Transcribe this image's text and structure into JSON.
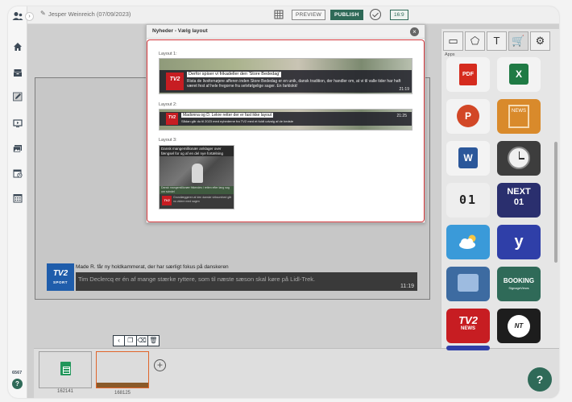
{
  "topbar": {
    "author": "Jesper Weinreich (07/09/2023)",
    "preview_label": "PREVIEW",
    "publish_label": "PUBLISH",
    "ratio_label": "16:9",
    "collapse_glyph": "›"
  },
  "sidebar": {
    "icons": [
      "users-icon",
      "home-icon",
      "inbox-icon",
      "edit-icon",
      "monitor-icon",
      "gallery-icon",
      "calendar-clock-icon",
      "calendar-grid-icon"
    ],
    "count": "6567",
    "help_glyph": "?"
  },
  "canvas": {
    "ticker": {
      "logo_text": "TV2",
      "logo_sub": "SPORT",
      "headline": "Made R. får ny holdkammerat, der har særligt fokus på danskeren",
      "text": "Tim Declercq er én af mange stærke ryttere, som til næste sæson skal køre på Lidl-Trek.",
      "time": "11:19"
    }
  },
  "toolstrip": {
    "glyphs": [
      "‹",
      "❐",
      "⌫",
      "🗑"
    ]
  },
  "filmstrip": {
    "slides": [
      {
        "label": "162141",
        "icon": "spreadsheet-icon"
      },
      {
        "label": "168125",
        "icon": ""
      }
    ],
    "add_glyph": "+"
  },
  "help_button": "?",
  "right_panel": {
    "tabs": [
      "image-icon",
      "shapes-icon",
      "text-icon",
      "cart-icon",
      "settings-icon"
    ],
    "tab_glyphs": [
      "▭",
      "⬠",
      "T",
      "🛒",
      "⚙"
    ],
    "apps_label": "Apps",
    "apps": [
      {
        "name": "pdf",
        "text": "PDF"
      },
      {
        "name": "excel",
        "text": "X"
      },
      {
        "name": "powerpoint",
        "text": "P"
      },
      {
        "name": "news",
        "text": "NEWS"
      },
      {
        "name": "word",
        "text": "W"
      },
      {
        "name": "clock",
        "text": ""
      },
      {
        "name": "counter",
        "text": "01"
      },
      {
        "name": "next",
        "text": "NEXT",
        "sub": "01"
      },
      {
        "name": "weather",
        "text": ""
      },
      {
        "name": "yeti",
        "text": "y"
      },
      {
        "name": "signage",
        "text": ""
      },
      {
        "name": "booking",
        "text": "BOOKING",
        "sub": "SignageViews"
      },
      {
        "name": "tv2-news",
        "text": "TV2",
        "sub": "NEWS"
      },
      {
        "name": "nt",
        "text": "NT"
      }
    ]
  },
  "modal": {
    "title": "Nyheder - Vælg layout",
    "close_glyph": "×",
    "layouts": [
      {
        "label": "Layout 1:",
        "logo": "TV2",
        "headline": "Derfor spiser vi frikadeller den 'Store Bededag'",
        "text": "Rista de livsfornøjere afferen inden Store Bededag er en unik, dansk tradition, der handler om, at vi til valle tider har haft været fest af hele fregorne fra selvfølgelige sager. En farklokk!",
        "time": "21:19"
      },
      {
        "label": "Layout 2:",
        "logo": "TV2",
        "headline": "Madonna og D. Lekre retter der er fast ikke layout",
        "text": "Sådan går du til 2023 med nyhederne fra TV2 med et fuldt udvalg af de bedste",
        "time": "21:25"
      },
      {
        "label": "Layout 3:",
        "logo": "TV2",
        "top_text": "Dansk mangemillionær anklager over fængsel for og af en del nye fortælning",
        "stripe_text": "Dansk mangemillionær frikendes i retten efter lang sag om svindel",
        "bottom_text": "Grundlæggeren af den danske virksomhed går nu videre med sagen"
      }
    ]
  }
}
